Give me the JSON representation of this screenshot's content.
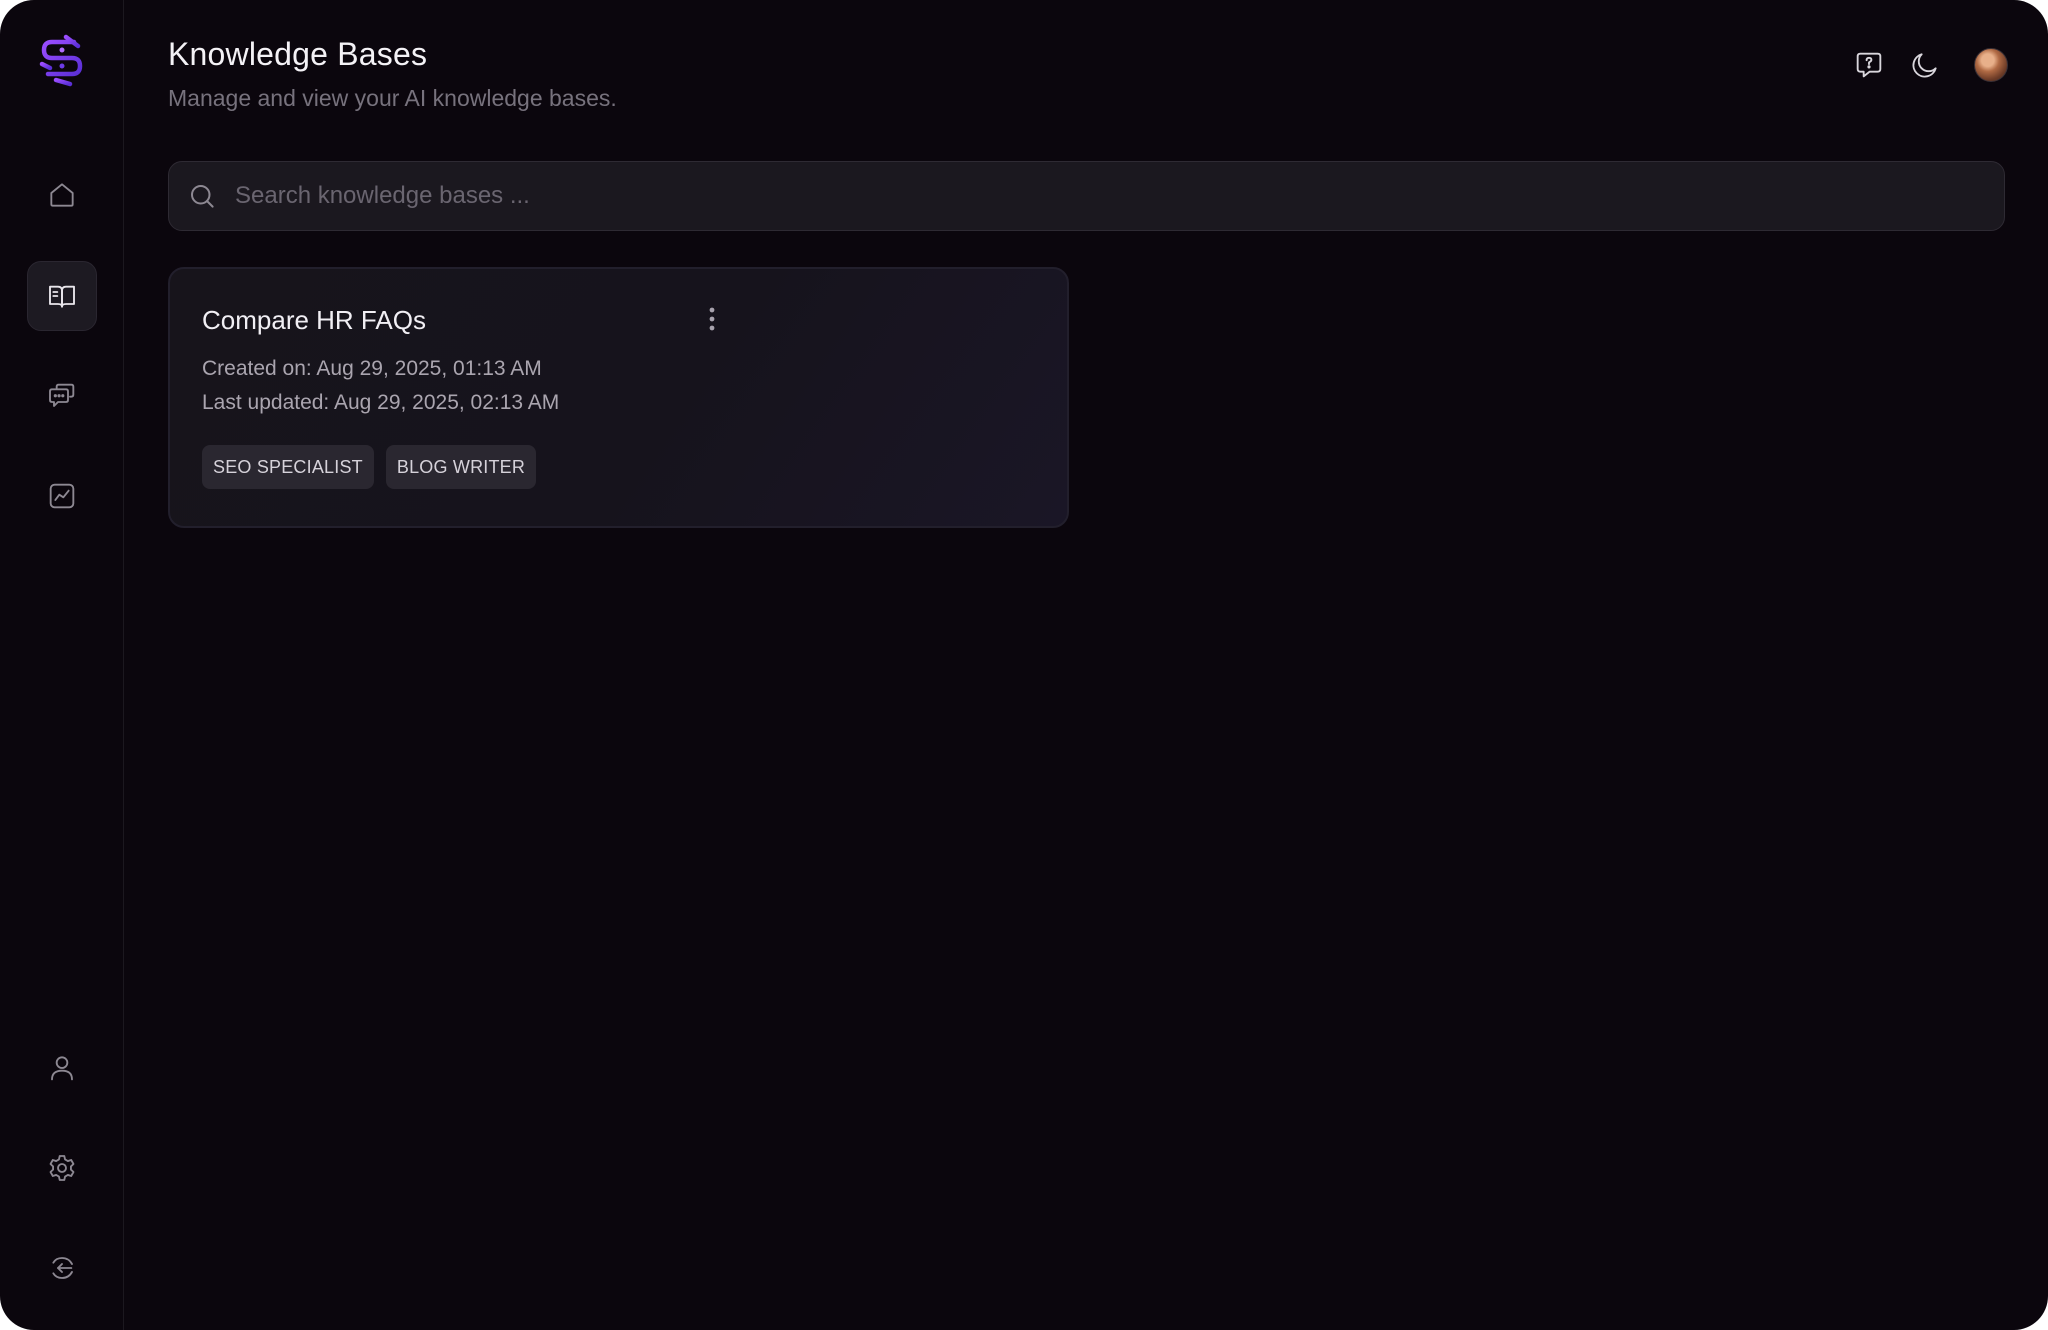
{
  "header": {
    "title": "Knowledge Bases",
    "subtitle": "Manage and view your AI knowledge bases."
  },
  "search": {
    "placeholder": "Search knowledge bases ...",
    "value": ""
  },
  "sidebar": {
    "items": [
      {
        "name": "home",
        "icon": "home-icon",
        "active": false
      },
      {
        "name": "knowledge-bases",
        "icon": "book-open-icon",
        "active": true
      },
      {
        "name": "chats",
        "icon": "chat-bubbles-icon",
        "active": false
      },
      {
        "name": "analytics",
        "icon": "chart-icon",
        "active": false
      },
      {
        "name": "profile",
        "icon": "user-icon",
        "active": false
      },
      {
        "name": "settings",
        "icon": "gear-icon",
        "active": false
      },
      {
        "name": "logout",
        "icon": "logout-icon",
        "active": false
      }
    ]
  },
  "top_icons": [
    "help-chat-icon",
    "moon-icon",
    "avatar"
  ],
  "cards": [
    {
      "title": "Compare HR FAQs",
      "created": "Created on: Aug 29, 2025, 01:13 AM",
      "updated": "Last updated: Aug 29, 2025, 02:13 AM",
      "tags": [
        "SEO SPECIALIST",
        "BLOG WRITER"
      ]
    }
  ],
  "colors": {
    "background": "#0b060d",
    "brand": "#7b3fe4",
    "card_bg": "#17141b",
    "tag_bg": "#2a2730"
  }
}
